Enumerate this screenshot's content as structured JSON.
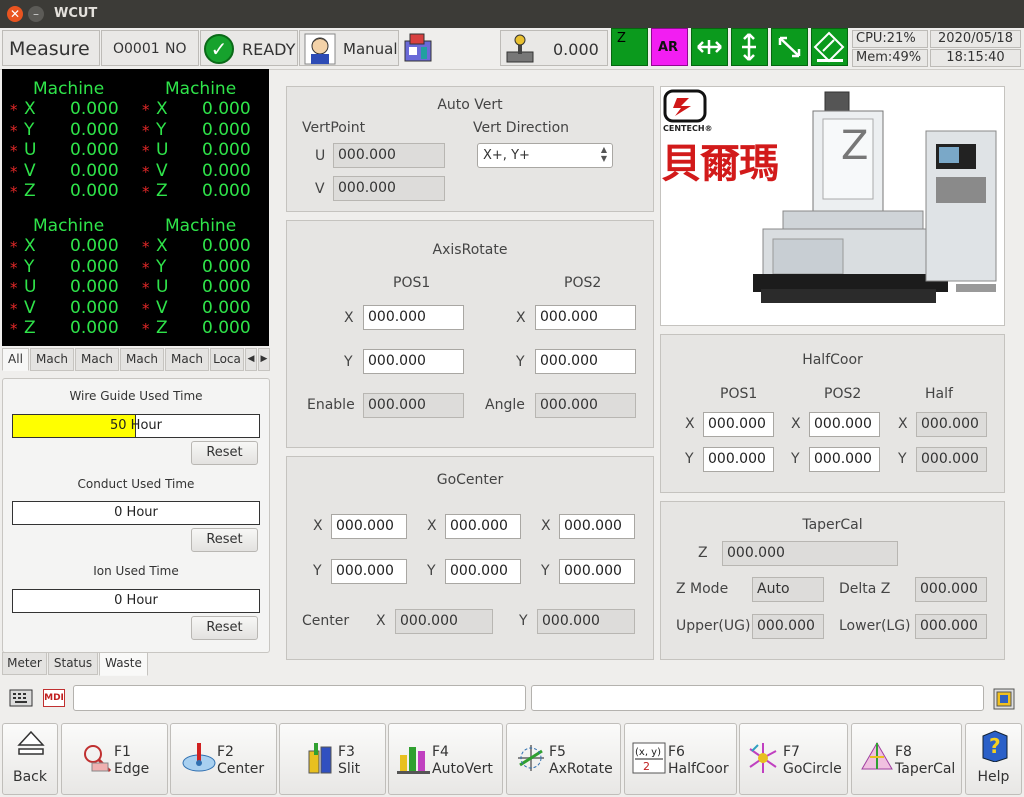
{
  "window": {
    "title": "WCUT"
  },
  "status": {
    "mode": "Measure",
    "program": "O0001",
    "program_flag": "NO",
    "state": "READY",
    "operation": "Manual",
    "feed_value": "0.000",
    "cpu": "CPU:21%",
    "mem": "Mem:49%",
    "date": "2020/05/18",
    "time": "18:15:40"
  },
  "toolbar": {
    "z_label": "Z",
    "ar_label": "AR"
  },
  "coords": {
    "blocks": [
      {
        "title_left": "Machine",
        "title_right": "Machine",
        "rows": [
          {
            "axis": "X",
            "left": "0.000",
            "right": "0.000"
          },
          {
            "axis": "Y",
            "left": "0.000",
            "right": "0.000"
          },
          {
            "axis": "U",
            "left": "0.000",
            "right": "0.000"
          },
          {
            "axis": "V",
            "left": "0.000",
            "right": "0.000"
          },
          {
            "axis": "Z",
            "left": "0.000",
            "right": "0.000"
          }
        ]
      },
      {
        "title_left": "Machine",
        "title_right": "Machine",
        "rows": [
          {
            "axis": "X",
            "left": "0.000",
            "right": "0.000"
          },
          {
            "axis": "Y",
            "left": "0.000",
            "right": "0.000"
          },
          {
            "axis": "U",
            "left": "0.000",
            "right": "0.000"
          },
          {
            "axis": "V",
            "left": "0.000",
            "right": "0.000"
          },
          {
            "axis": "Z",
            "left": "0.000",
            "right": "0.000"
          }
        ]
      }
    ],
    "star": "*",
    "tabs": [
      "All",
      "Mach",
      "Mach",
      "Mach",
      "Mach",
      "Loca"
    ]
  },
  "wear": {
    "wire_title": "Wire Guide Used Time",
    "wire_value": "50 Hour",
    "wire_level": 0.5,
    "conduct_title": "Conduct Used Time",
    "conduct_value": "0 Hour",
    "ion_title": "Ion Used Time",
    "ion_value": "0 Hour",
    "reset": "Reset",
    "tabs": [
      "Meter",
      "Status",
      "Waste"
    ]
  },
  "autovert": {
    "title": "Auto Vert",
    "vertpoint": "VertPoint",
    "vertdir": "Vert Direction",
    "u_label": "U",
    "u_value": "000.000",
    "v_label": "V",
    "v_value": "000.000",
    "direction": "X+, Y+"
  },
  "axisrotate": {
    "title": "AxisRotate",
    "pos1": "POS1",
    "pos2": "POS2",
    "x1": "000.000",
    "x2": "000.000",
    "y1": "000.000",
    "y2": "000.000",
    "enable_label": "Enable",
    "enable": "000.000",
    "angle_label": "Angle",
    "angle": "000.000"
  },
  "gocenter": {
    "title": "GoCenter",
    "x": [
      "000.000",
      "000.000",
      "000.000"
    ],
    "y": [
      "000.000",
      "000.000",
      "000.000"
    ],
    "center_label": "Center",
    "cx": "000.000",
    "cy": "000.000"
  },
  "halfcoor": {
    "title": "HalfCoor",
    "pos1": "POS1",
    "pos2": "POS2",
    "half": "Half",
    "x": [
      "000.000",
      "000.000",
      "000.000"
    ],
    "y": [
      "000.000",
      "000.000",
      "000.000"
    ]
  },
  "tapercal": {
    "title": "TaperCal",
    "z_label": "Z",
    "z": "000.000",
    "zmode_label": "Z Mode",
    "zmode": "Auto",
    "deltaz_label": "Delta Z",
    "deltaz": "000.000",
    "upper_label": "Upper(UG)",
    "upper": "000.000",
    "lower_label": "Lower(LG)",
    "lower": "000.000"
  },
  "brand": {
    "logo_text": "CENTECH®",
    "cn_name": "貝爾瑪"
  },
  "cmd": {
    "mdi": "MDI"
  },
  "fkeys": {
    "back": "Back",
    "f1": {
      "num": "F1",
      "name": "Edge"
    },
    "f2": {
      "num": "F2",
      "name": "Center"
    },
    "f3": {
      "num": "F3",
      "name": "Slit"
    },
    "f4": {
      "num": "F4",
      "name": "AutoVert"
    },
    "f5": {
      "num": "F5",
      "name": "AxRotate"
    },
    "f6": {
      "num": "F6",
      "name": "HalfCoor"
    },
    "f7": {
      "num": "F7",
      "name": "GoCircle"
    },
    "f8": {
      "num": "F8",
      "name": "TaperCal"
    },
    "help": "Help"
  }
}
